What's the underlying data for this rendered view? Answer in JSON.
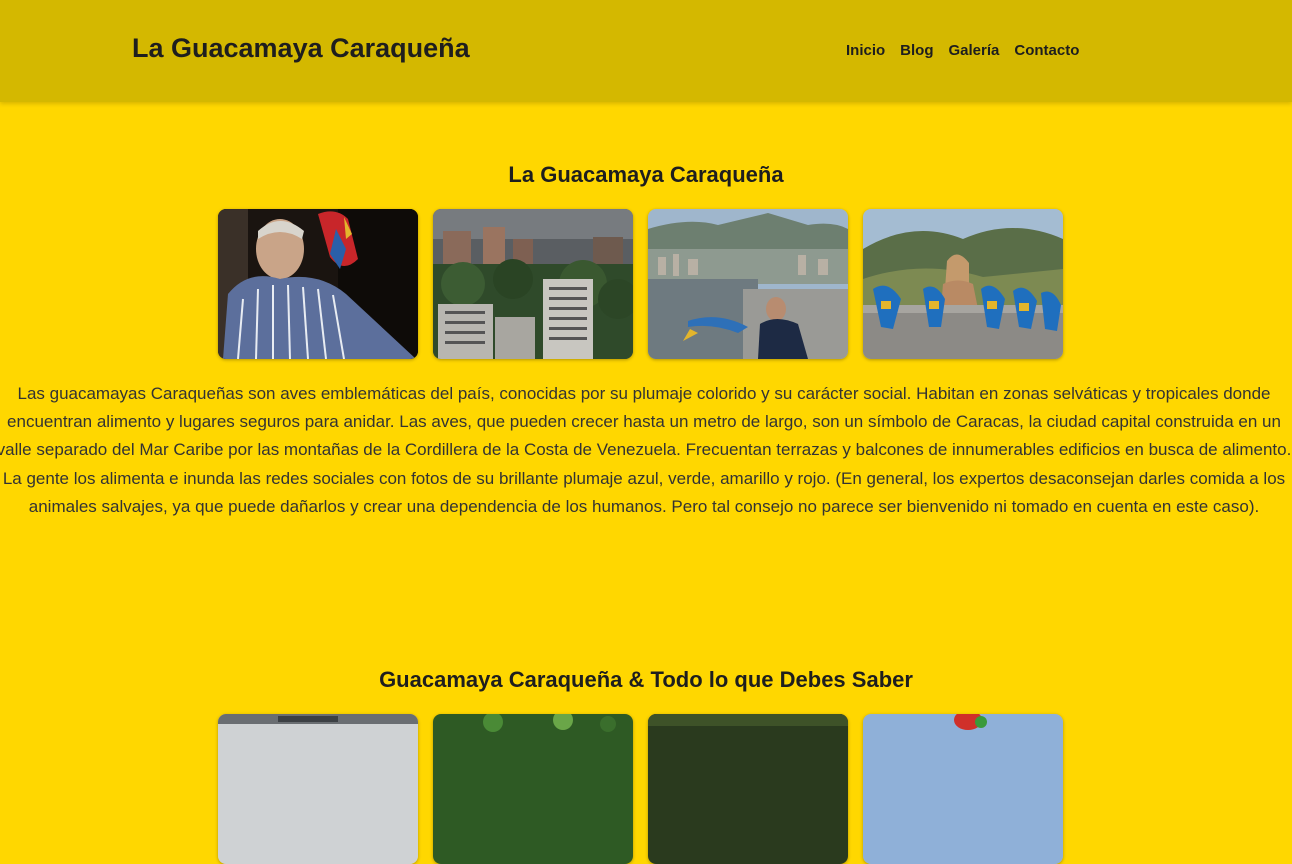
{
  "header": {
    "site_title": "La Guacamaya Caraqueña",
    "nav": [
      "Inicio",
      "Blog",
      "Galería",
      "Contacto"
    ]
  },
  "section1": {
    "title": "La Guacamaya Caraqueña",
    "description": "Las guacamayas Caraqueñas son aves emblemáticas del país, conocidas por su plumaje colorido y su carácter social. Habitan en zonas selváticas y tropicales donde encuentran alimento y lugares seguros para anidar. Las aves, que pueden crecer hasta un metro de largo, son un símbolo de Caracas, la ciudad capital construida en un valle separado del Mar Caribe por las montañas de la Cordillera de la Costa de Venezuela. Frecuentan terrazas y balcones de innumerables edificios en busca de alimento. La gente los alimenta e inunda las redes sociales con fotos de su brillante plumaje azul, verde, amarillo y rojo. (En general, los expertos desaconsejan darles comida a los animales salvajes, ya que puede dañarlos y crear una dependencia de los humanos. Pero tal consejo no parece ser bienvenido ni tomado en cuenta en este caso)."
  },
  "section2": {
    "title": "Guacamaya Caraqueña & Todo lo que Debes Saber"
  },
  "colors": {
    "page_bg": "#FFD700",
    "header_bg": "#D4B800",
    "text": "#1e1e1e"
  }
}
